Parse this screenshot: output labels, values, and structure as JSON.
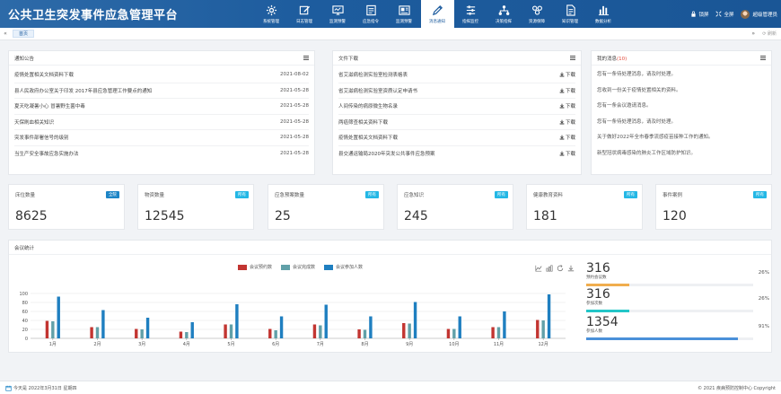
{
  "header": {
    "title": "公共卫生突发事件应急管理平台",
    "nav": [
      {
        "label": "系统管理",
        "icon": "gear-icon"
      },
      {
        "label": "日志管理",
        "icon": "edit-icon"
      },
      {
        "label": "监测预警",
        "icon": "monitor-icon"
      },
      {
        "label": "应急指令",
        "icon": "command-icon"
      },
      {
        "label": "监测预警",
        "icon": "dashboard-icon"
      },
      {
        "label": "消息通知",
        "icon": "pen-icon",
        "active": true
      },
      {
        "label": "指挥监控",
        "icon": "sliders-icon"
      },
      {
        "label": "决策指挥",
        "icon": "network-icon"
      },
      {
        "label": "资源保障",
        "icon": "group-icon"
      },
      {
        "label": "知识管理",
        "icon": "document-icon"
      },
      {
        "label": "数据分析",
        "icon": "bar-chart-icon"
      }
    ],
    "lock_label": "锁屏",
    "fullscreen_label": "全屏",
    "user_name": "超级管理员"
  },
  "tabs": {
    "home_label": "首页",
    "refresh_label": "刷新"
  },
  "notice": {
    "title": "通知公告",
    "items": [
      {
        "text": "疫情处置相关文档资料下载",
        "date": "2021-08-02"
      },
      {
        "text": "县人民政府办公室关于印发 2017年县应急管理工作要点的通知",
        "date": "2021-05-28"
      },
      {
        "text": "夏天吃凝暑小心 冒暑野生菌中毒",
        "date": "2021-05-28"
      },
      {
        "text": "天保刷血相关知识",
        "date": "2021-05-28"
      },
      {
        "text": "突发事件部署信号的级别",
        "date": "2021-05-28"
      },
      {
        "text": "当生产安全事故应急实施办法",
        "date": "2021-05-28"
      }
    ]
  },
  "files": {
    "title": "文件下载",
    "download_label": "下载",
    "items": [
      "省艾滋病检测实验室检测表格表",
      "省艾滋病检测实验室资质认定申请书",
      "人间传染的病原微生物名录",
      "两癌筛查相关资料下载",
      "疫情处置相关文档资料下载",
      "县交通运输局2020年突发公共事件应急预案"
    ]
  },
  "messages": {
    "title": "我的消息",
    "count": "(10)",
    "items": [
      "您有一条待处理消息，请及时处理。",
      "您收到一份关于疫情处置相关的资料。",
      "您有一条会议邀请消息。",
      "您有一条待处理消息，请及时处理。",
      "关于做好2022年全市春季流感疫苗接种工作的通知。",
      "新型冠状病毒感染的肺炎工作区域防护知识。"
    ]
  },
  "stats": [
    {
      "label": "床位数量",
      "badge": "全院",
      "value": "8625"
    },
    {
      "label": "物资数量",
      "badge": "所有",
      "value": "12545"
    },
    {
      "label": "应急预案数量",
      "badge": "所有",
      "value": "25"
    },
    {
      "label": "应急知识",
      "badge": "所有",
      "value": "245"
    },
    {
      "label": "健康教育资料",
      "badge": "所有",
      "value": "181"
    },
    {
      "label": "事件案例",
      "badge": "所有",
      "value": "120"
    }
  ],
  "meeting": {
    "title": "会议统计",
    "kpis": [
      {
        "value": "316",
        "label": "预约会议数",
        "percent": "26%",
        "fraction": 0.26,
        "color": "#f0ad4e"
      },
      {
        "value": "316",
        "label": "参加次数",
        "percent": "26%",
        "fraction": 0.26,
        "color": "#23c6c8"
      },
      {
        "value": "1354",
        "label": "参加人数",
        "percent": "91%",
        "fraction": 0.91,
        "color": "#4a90d9"
      }
    ]
  },
  "chart_data": {
    "type": "bar",
    "categories": [
      "1月",
      "2月",
      "3月",
      "4月",
      "5月",
      "6月",
      "7月",
      "8月",
      "9月",
      "10月",
      "11月",
      "12月"
    ],
    "series": [
      {
        "name": "会议预约数",
        "color": "#c23531",
        "values": [
          39,
          25,
          21,
          15,
          31,
          21,
          31,
          20,
          34,
          21,
          25,
          41
        ]
      },
      {
        "name": "会议完成数",
        "color": "#61a0a8",
        "values": [
          38,
          25,
          20,
          14,
          31,
          18,
          29,
          19,
          33,
          21,
          25,
          40
        ]
      },
      {
        "name": "会议参加人数",
        "color": "#1f7fc0",
        "values": [
          93,
          63,
          46,
          36,
          76,
          49,
          75,
          49,
          81,
          49,
          60,
          98
        ]
      }
    ],
    "ylim": [
      0,
      100
    ],
    "yticks": [
      0,
      20,
      40,
      60,
      80,
      100
    ]
  },
  "footer": {
    "today": "今天是 2022年3月31日 星期四",
    "copyright": "© 2021 疾病预防控制中心 Copyright"
  }
}
